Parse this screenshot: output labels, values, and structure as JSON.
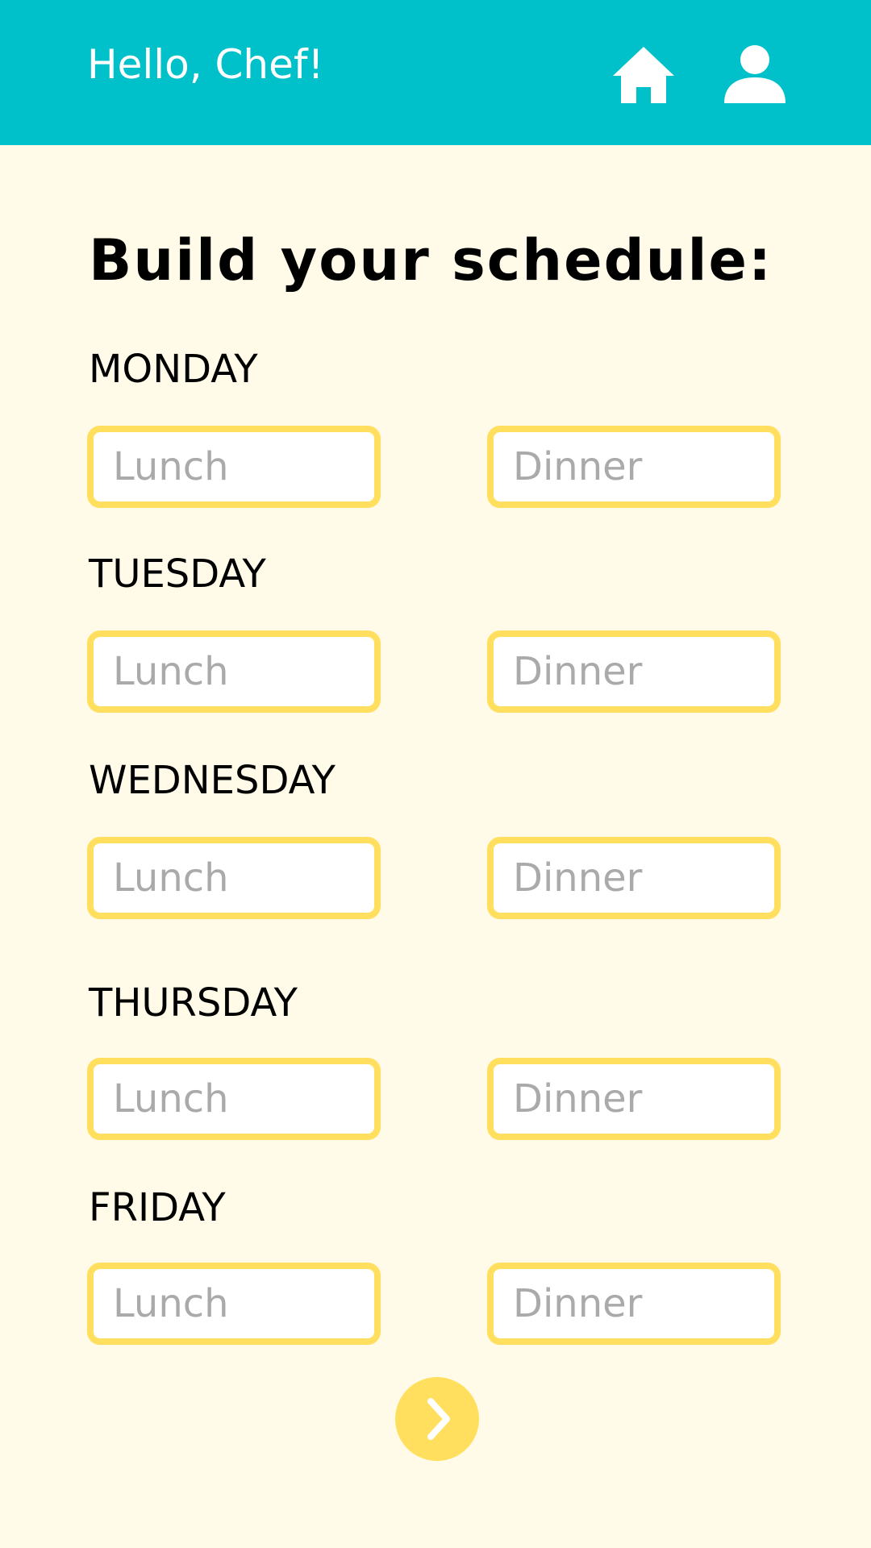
{
  "header": {
    "greeting": "Hello, Chef!",
    "home_icon": "home-icon",
    "profile_icon": "user-icon"
  },
  "main": {
    "title": "Build your schedule:",
    "days": [
      {
        "label": "MONDAY",
        "lunch_placeholder": "Lunch",
        "dinner_placeholder": "Dinner"
      },
      {
        "label": "TUESDAY",
        "lunch_placeholder": "Lunch",
        "dinner_placeholder": "Dinner"
      },
      {
        "label": "WEDNESDAY",
        "lunch_placeholder": "Lunch",
        "dinner_placeholder": "Dinner"
      },
      {
        "label": "THURSDAY",
        "lunch_placeholder": "Lunch",
        "dinner_placeholder": "Dinner"
      },
      {
        "label": "FRIDAY",
        "lunch_placeholder": "Lunch",
        "dinner_placeholder": "Dinner"
      }
    ]
  },
  "next_button": {
    "icon": "chevron-right-icon"
  },
  "colors": {
    "header_bg": "#00C0C9",
    "page_bg": "#FFFBE8",
    "accent": "#FFDF5D",
    "placeholder": "#AAAAAA"
  }
}
